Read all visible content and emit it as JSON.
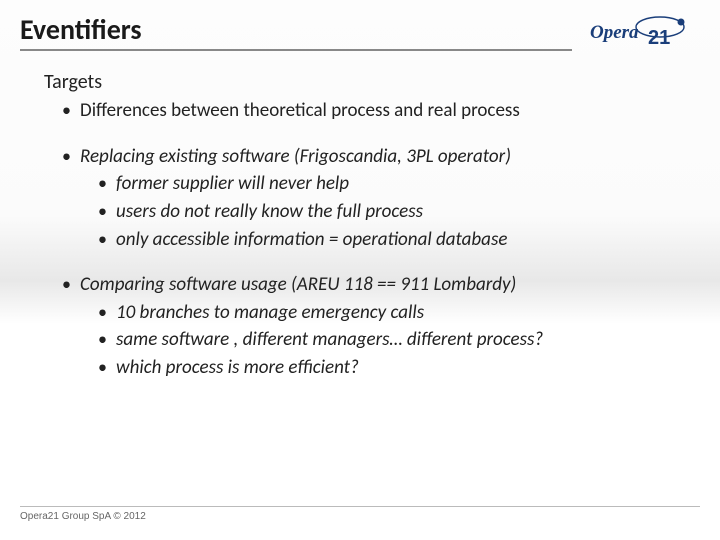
{
  "header": {
    "title": "Eventifiers",
    "logo_text_top": "Opera",
    "logo_text_num": "21"
  },
  "content": {
    "targets_label": "Targets",
    "b1": "Differences between theoretical process and real process",
    "b2": "Replacing existing software (Frigoscandia, 3PL operator)",
    "b2s1": " former supplier will never help",
    "b2s2": "users do not really know the full process",
    "b2s3": "only accessible information = operational database",
    "b3": "Comparing software usage (AREU 118  == 911 Lombardy)",
    "b3s1": " 10 branches to manage emergency calls",
    "b3s2": "same software , different managers… different process?",
    "b3s3": "which process is more efficient?"
  },
  "footer": {
    "copyright": "Opera21 Group SpA © 2012"
  }
}
